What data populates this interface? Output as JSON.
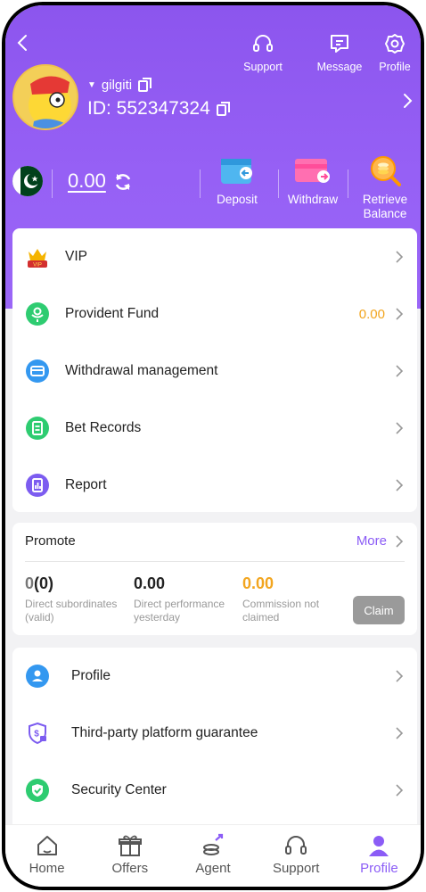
{
  "header": {
    "top_icons": {
      "support": "Support",
      "message": "Message",
      "profile": "Profile"
    },
    "user": {
      "name": "gilgiti",
      "id": "ID: 552347324"
    },
    "balance": "0.00",
    "actions": {
      "deposit": "Deposit",
      "withdraw": "Withdraw",
      "retrieve_line1": "Retrieve",
      "retrieve_line2": "Balance"
    }
  },
  "menu": [
    {
      "label": "VIP",
      "icon": "vip-icon"
    },
    {
      "label": "Provident Fund",
      "value": "0.00",
      "icon": "provident-fund-icon"
    },
    {
      "label": "Withdrawal management",
      "icon": "wallet-icon"
    },
    {
      "label": "Bet Records",
      "icon": "bet-records-icon"
    },
    {
      "label": "Report",
      "icon": "report-icon"
    }
  ],
  "promote": {
    "title": "Promote",
    "more": "More",
    "stats": [
      {
        "value_main": "0",
        "value_paren": "(0)",
        "label_line1": "Direct subordinates",
        "label_line2": "(valid)"
      },
      {
        "value": "0.00",
        "label_line1": "Direct performance",
        "label_line2": "yesterday"
      },
      {
        "value": "0.00",
        "label_line1": "Commission not",
        "label_line2": "claimed"
      }
    ],
    "claim": "Claim"
  },
  "settings": [
    {
      "label": "Profile",
      "icon": "profile-icon"
    },
    {
      "label": "Third-party platform guarantee",
      "icon": "shield-dollar-icon"
    },
    {
      "label": "Security Center",
      "icon": "security-shield-icon"
    }
  ],
  "nav": [
    {
      "label": "Home",
      "icon": "home-icon"
    },
    {
      "label": "Offers",
      "icon": "gift-icon"
    },
    {
      "label": "Agent",
      "icon": "agent-icon"
    },
    {
      "label": "Support",
      "icon": "headset-icon"
    },
    {
      "label": "Profile",
      "icon": "user-icon",
      "active": true
    }
  ],
  "colors": {
    "accent": "#8b5cf6",
    "header": "#9660f5",
    "amount": "#f2a51f",
    "claim_bg": "#9a9a9a"
  }
}
